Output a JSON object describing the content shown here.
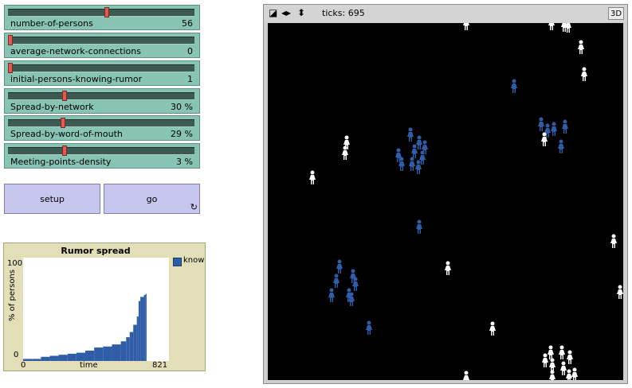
{
  "sliders": [
    {
      "name": "number-of-persons",
      "value": "56",
      "fraction": 0.53
    },
    {
      "name": "average-network-connections",
      "value": "0",
      "fraction": 0.0
    },
    {
      "name": "initial-persons-knowing-rumor",
      "value": "1",
      "fraction": 0.0
    },
    {
      "name": "Spread-by-network",
      "value": "30 %",
      "fraction": 0.3
    },
    {
      "name": "Spread-by-word-of-mouth",
      "value": "29 %",
      "fraction": 0.29
    },
    {
      "name": "Meeting-points-density",
      "value": "3 %",
      "fraction": 0.3
    }
  ],
  "buttons": {
    "setup": "setup",
    "go": "go",
    "forever_icon": "↻"
  },
  "plot": {
    "title": "Rumor spread",
    "legend": "know",
    "ylabel": "% of persons",
    "xlabel": "time",
    "ymin_label": "0",
    "ymax_label": "100",
    "xmin_label": "0",
    "xmax_label": "821"
  },
  "view": {
    "ticks_label": "ticks:",
    "ticks": "695",
    "button_3d": "3D",
    "icons": [
      "edit-icon",
      "speed-left-right-icon",
      "speed-up-down-icon"
    ]
  },
  "colors": {
    "slider_bg": "#88c4b4",
    "button_bg": "#c6c6ee",
    "plot_bg": "#e2dfb8",
    "know": "#2f5da8",
    "unaware": "#ffffff",
    "world": "#000000"
  },
  "chart_data": {
    "type": "area",
    "title": "Rumor spread",
    "xlabel": "time",
    "ylabel": "% of persons",
    "xlim": [
      0,
      821
    ],
    "ylim": [
      0,
      100
    ],
    "series": [
      {
        "name": "know",
        "x": [
          0,
          50,
          100,
          150,
          200,
          250,
          300,
          350,
          400,
          450,
          500,
          550,
          580,
          600,
          620,
          640,
          650,
          660,
          680,
          690,
          695
        ],
        "values": [
          2,
          2,
          4,
          5,
          6,
          7,
          8,
          10,
          13,
          14,
          16,
          19,
          23,
          28,
          35,
          43,
          58,
          62,
          64,
          65,
          65
        ]
      }
    ]
  },
  "agents": [
    {
      "x": 249,
      "y": 0,
      "k": 0
    },
    {
      "x": 356,
      "y": 0,
      "k": 0
    },
    {
      "x": 372,
      "y": 2,
      "k": 0
    },
    {
      "x": 377,
      "y": 3,
      "k": 0
    },
    {
      "x": 393,
      "y": 30,
      "k": 0
    },
    {
      "x": 397,
      "y": 64,
      "k": 0
    },
    {
      "x": 309,
      "y": 79,
      "k": 1
    },
    {
      "x": 99,
      "y": 150,
      "k": 0
    },
    {
      "x": 97,
      "y": 163,
      "k": 0
    },
    {
      "x": 56,
      "y": 194,
      "k": 0
    },
    {
      "x": 179,
      "y": 140,
      "k": 1
    },
    {
      "x": 190,
      "y": 150,
      "k": 1
    },
    {
      "x": 197,
      "y": 156,
      "k": 1
    },
    {
      "x": 184,
      "y": 161,
      "k": 1
    },
    {
      "x": 164,
      "y": 166,
      "k": 1
    },
    {
      "x": 168,
      "y": 177,
      "k": 1
    },
    {
      "x": 181,
      "y": 177,
      "k": 1
    },
    {
      "x": 189,
      "y": 181,
      "k": 1
    },
    {
      "x": 194,
      "y": 169,
      "k": 1
    },
    {
      "x": 343,
      "y": 127,
      "k": 1
    },
    {
      "x": 351,
      "y": 135,
      "k": 1
    },
    {
      "x": 359,
      "y": 133,
      "k": 1
    },
    {
      "x": 373,
      "y": 130,
      "k": 1
    },
    {
      "x": 347,
      "y": 146,
      "k": 0
    },
    {
      "x": 368,
      "y": 155,
      "k": 1
    },
    {
      "x": 190,
      "y": 256,
      "k": 1
    },
    {
      "x": 90,
      "y": 306,
      "k": 1
    },
    {
      "x": 107,
      "y": 318,
      "k": 1
    },
    {
      "x": 86,
      "y": 324,
      "k": 1
    },
    {
      "x": 110,
      "y": 328,
      "k": 1
    },
    {
      "x": 80,
      "y": 342,
      "k": 1
    },
    {
      "x": 102,
      "y": 342,
      "k": 1
    },
    {
      "x": 105,
      "y": 347,
      "k": 1
    },
    {
      "x": 127,
      "y": 383,
      "k": 1
    },
    {
      "x": 226,
      "y": 308,
      "k": 0
    },
    {
      "x": 282,
      "y": 384,
      "k": 0
    },
    {
      "x": 434,
      "y": 274,
      "k": 0
    },
    {
      "x": 442,
      "y": 338,
      "k": 0
    },
    {
      "x": 355,
      "y": 414,
      "k": 0
    },
    {
      "x": 348,
      "y": 424,
      "k": 0
    },
    {
      "x": 369,
      "y": 414,
      "k": 0
    },
    {
      "x": 379,
      "y": 420,
      "k": 0
    },
    {
      "x": 357,
      "y": 430,
      "k": 0
    },
    {
      "x": 371,
      "y": 434,
      "k": 0
    },
    {
      "x": 378,
      "y": 444,
      "k": 0
    },
    {
      "x": 385,
      "y": 442,
      "k": 0
    },
    {
      "x": 357,
      "y": 445,
      "k": 0
    },
    {
      "x": 249,
      "y": 446,
      "k": 0
    }
  ]
}
